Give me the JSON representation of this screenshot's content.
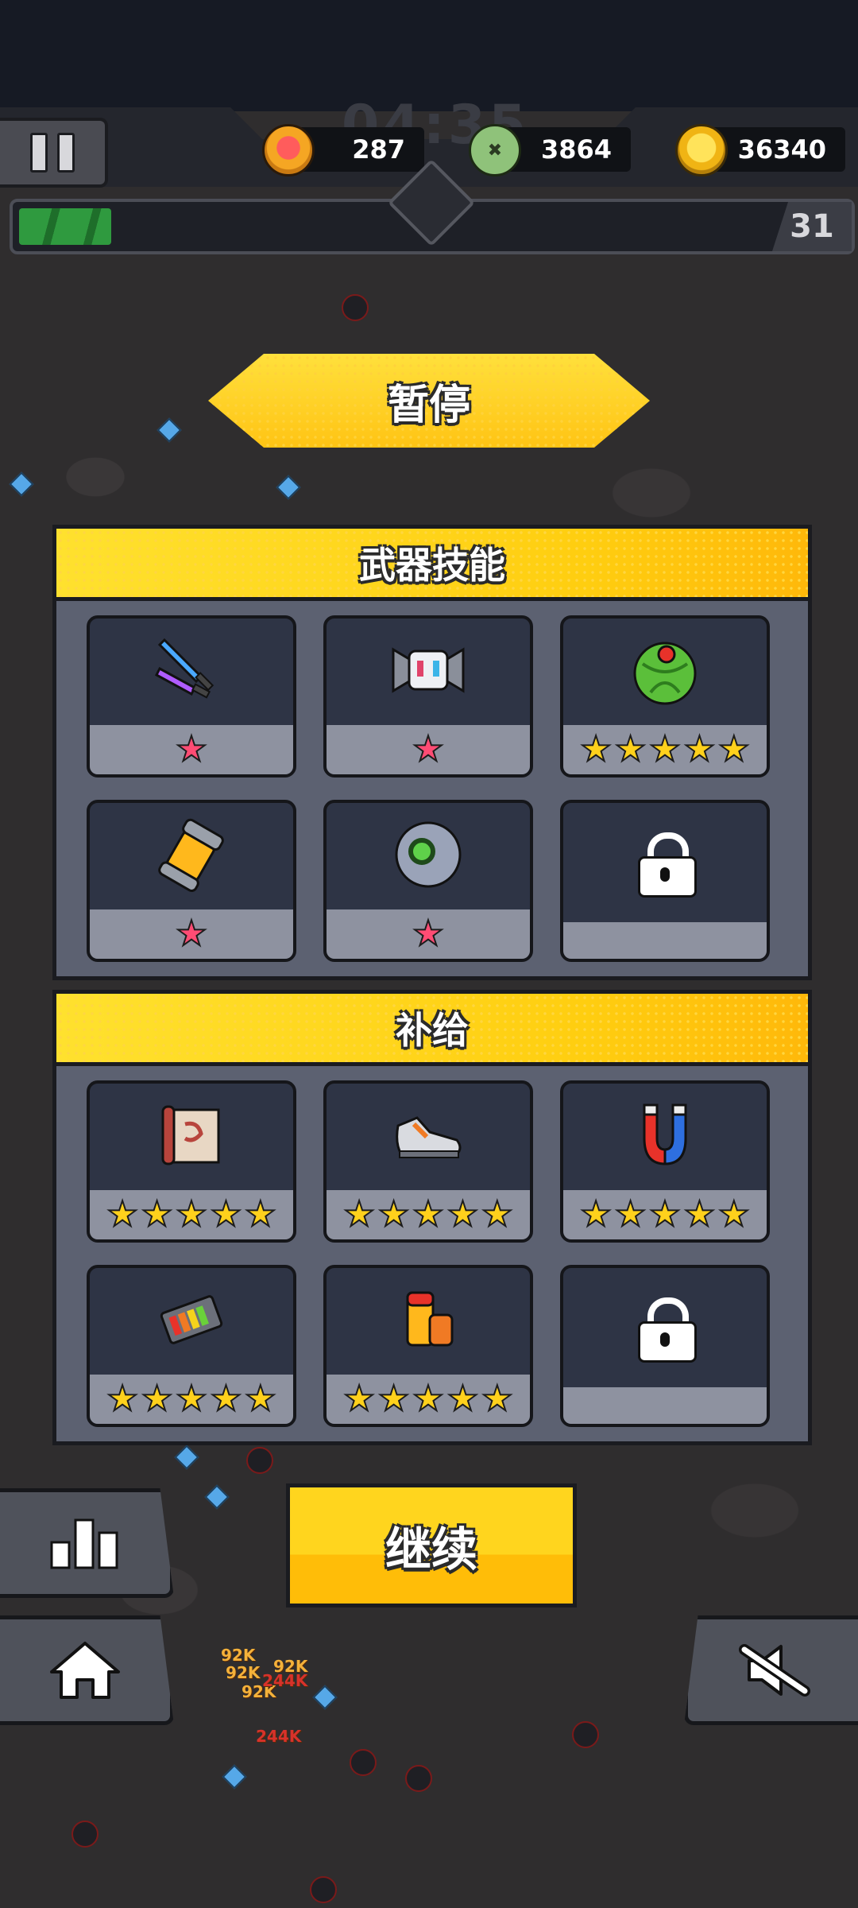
{
  "hud": {
    "timer": "04:35",
    "hp": "287",
    "kills": "3864",
    "coins": "36340",
    "level": "31",
    "xp_progress": 0.11,
    "icons": {
      "pause": "pause-icon",
      "hp": "heart-icon",
      "kills": "zombie-skull-icon",
      "coins": "gold-coin-icon"
    }
  },
  "dialog": {
    "title": "暂停"
  },
  "weapons": {
    "title": "武器技能",
    "slots": [
      {
        "icon": "dual-swords-icon",
        "stars": 1,
        "star_color": "#ff4c74"
      },
      {
        "icon": "robot-drone-icon",
        "stars": 1,
        "star_color": "#ff4c74"
      },
      {
        "icon": "green-ball-icon",
        "stars": 5,
        "star_color": "#ffd11c"
      },
      {
        "icon": "fuel-canister-icon",
        "stars": 1,
        "star_color": "#ff4c74"
      },
      {
        "icon": "grey-orb-icon",
        "stars": 1,
        "star_color": "#ff4c74"
      },
      {
        "icon": "lock-icon",
        "stars": 0,
        "locked": true
      }
    ]
  },
  "supplies": {
    "title": "补给",
    "slots": [
      {
        "icon": "scroll-icon",
        "stars": 5
      },
      {
        "icon": "sneaker-icon",
        "stars": 5
      },
      {
        "icon": "magnet-icon",
        "stars": 5
      },
      {
        "icon": "battery-pack-icon",
        "stars": 5
      },
      {
        "icon": "energy-drink-icon",
        "stars": 5
      },
      {
        "icon": "lock-icon",
        "stars": 0,
        "locked": true
      }
    ]
  },
  "actions": {
    "continue_label": "继续",
    "stats_icon": "bar-chart-icon",
    "home_icon": "home-icon",
    "sound_icon": "sound-muted-icon"
  },
  "damage_numbers": [
    "92K",
    "92K",
    "92K",
    "92K",
    "244K",
    "244K"
  ],
  "colors": {
    "accent_yellow": "#ffd11c",
    "star_red": "#ff4c74",
    "panel": "#5c6171",
    "slot": "#2e3445"
  }
}
